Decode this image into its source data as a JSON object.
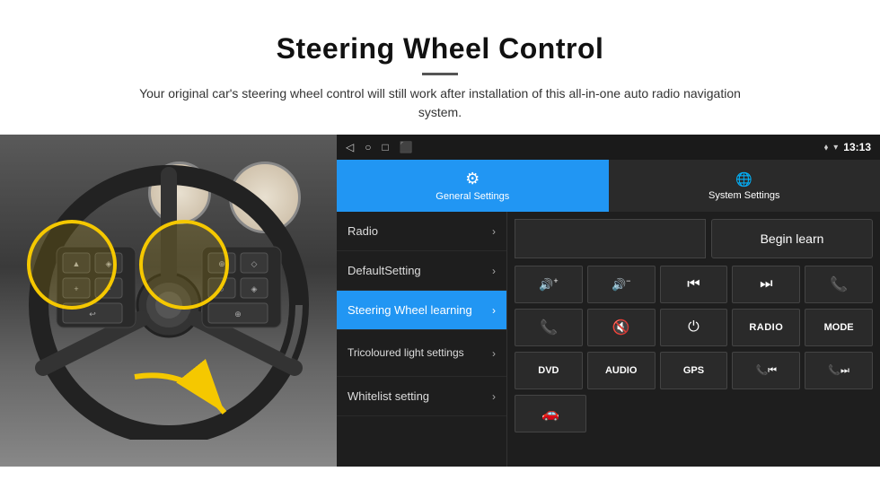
{
  "header": {
    "title": "Steering Wheel Control",
    "subtitle": "Your original car's steering wheel control will still work after installation of this all-in-one auto radio navigation system."
  },
  "status_bar": {
    "time": "13:13",
    "icons": [
      "◁",
      "○",
      "□",
      "⬛"
    ]
  },
  "tabs": [
    {
      "label": "General Settings",
      "icon": "⚙",
      "active": true
    },
    {
      "label": "System Settings",
      "icon": "🌐",
      "active": false
    }
  ],
  "menu_items": [
    {
      "label": "Radio",
      "active": false
    },
    {
      "label": "DefaultSetting",
      "active": false
    },
    {
      "label": "Steering Wheel learning",
      "active": true
    },
    {
      "label": "Tricoloured light settings",
      "active": false
    },
    {
      "label": "Whitelist setting",
      "active": false
    }
  ],
  "control_panel": {
    "begin_learn_label": "Begin learn",
    "buttons_row1": [
      "🔊+",
      "🔊−",
      "⏮",
      "⏭",
      "📞"
    ],
    "buttons_row2": [
      "📞",
      "🔇",
      "⏻",
      "RADIO",
      "MODE"
    ],
    "buttons_row3": [
      "DVD",
      "AUDIO",
      "GPS",
      "📞⏮",
      "📞⏭"
    ],
    "buttons_row4": [
      "🚗"
    ]
  }
}
